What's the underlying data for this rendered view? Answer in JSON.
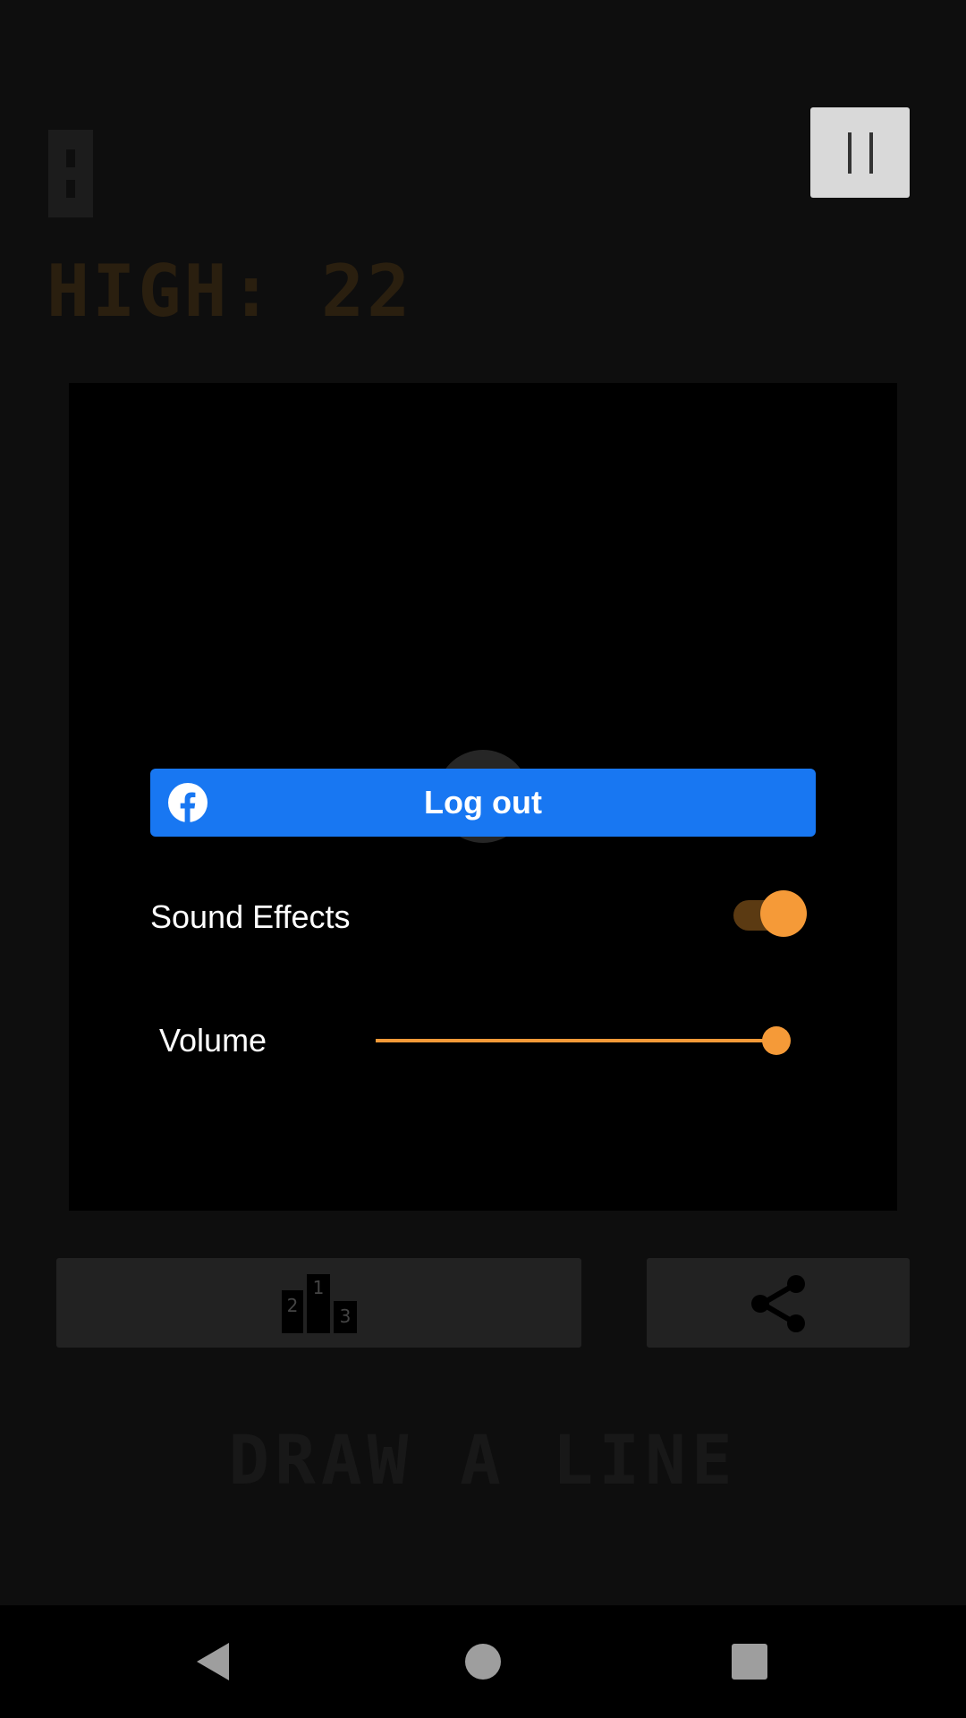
{
  "game": {
    "high_score": "HIGH: 22",
    "title": "DRAW A LINE"
  },
  "settings": {
    "facebook_button_label": "Log out",
    "sound_effects_label": "Sound Effects",
    "sound_effects_enabled": true,
    "volume_label": "Volume",
    "volume_level": 1.0
  },
  "colors": {
    "accent": "#f59a38",
    "facebook_blue": "#1877f2",
    "background": "#0e0e0e"
  },
  "icons": {
    "pause": "pause-icon",
    "facebook": "facebook-icon",
    "leaderboard": "podium-icon",
    "share": "share-icon",
    "nav_back": "back-icon",
    "nav_home": "home-icon",
    "nav_recents": "recents-icon"
  }
}
